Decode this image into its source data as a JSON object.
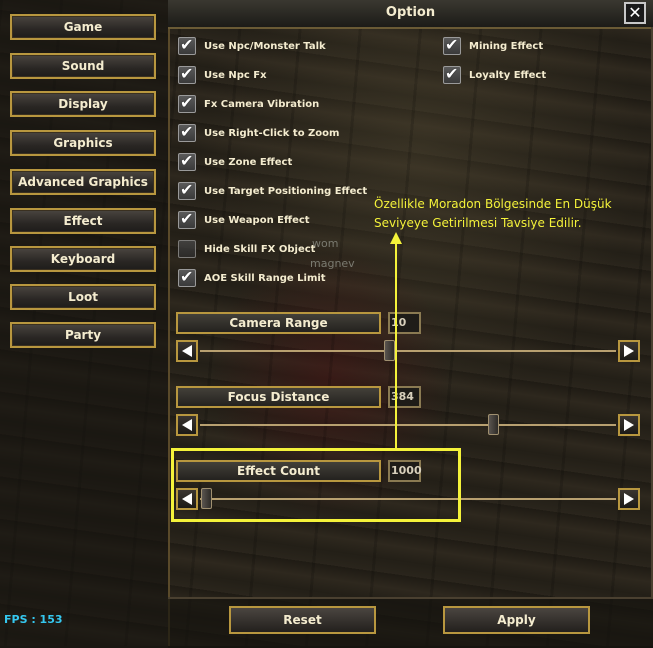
{
  "window": {
    "title": "Option",
    "close_icon": "close-icon"
  },
  "sidebar": {
    "items": [
      {
        "label": "Game"
      },
      {
        "label": "Sound"
      },
      {
        "label": "Display"
      },
      {
        "label": "Graphics"
      },
      {
        "label": "Advanced Graphics"
      },
      {
        "label": "Effect"
      },
      {
        "label": "Keyboard"
      },
      {
        "label": "Loot"
      },
      {
        "label": "Party"
      }
    ]
  },
  "status": {
    "fps_text": "FPS : 153",
    "fps_color": "#35c8f0"
  },
  "options_left": [
    {
      "label": "Use Npc/Monster Talk",
      "checked": true
    },
    {
      "label": "Use Npc Fx",
      "checked": true
    },
    {
      "label": "Fx Camera Vibration",
      "checked": true
    },
    {
      "label": "Use Right-Click to Zoom",
      "checked": true
    },
    {
      "label": "Use Zone Effect",
      "checked": true
    },
    {
      "label": "Use Target Positioning Effect",
      "checked": true
    },
    {
      "label": "Use Weapon Effect",
      "checked": true
    },
    {
      "label": "Hide Skill FX Object",
      "checked": false
    },
    {
      "label": "AOE Skill Range Limit",
      "checked": true
    }
  ],
  "options_right": [
    {
      "label": "Mining Effect",
      "checked": true
    },
    {
      "label": "Loyalty Effect",
      "checked": true
    }
  ],
  "sliders": [
    {
      "label": "Camera Range",
      "value": "10",
      "level": 0.45
    },
    {
      "label": "Focus Distance",
      "value": "384",
      "level": 0.7
    },
    {
      "label": "Effect Count",
      "value": "1000",
      "level": 0.0
    }
  ],
  "annotation": {
    "line1": "Özellikle Moradon Bölgesinde En Düşük",
    "line2": "Seviyeye Getirilmesi Tavsiye Edilir.",
    "color": "#f4f23a"
  },
  "background_text": {
    "t1": "wom",
    "t2": "magnev"
  },
  "buttons": {
    "reset": "Reset",
    "apply": "Apply"
  }
}
